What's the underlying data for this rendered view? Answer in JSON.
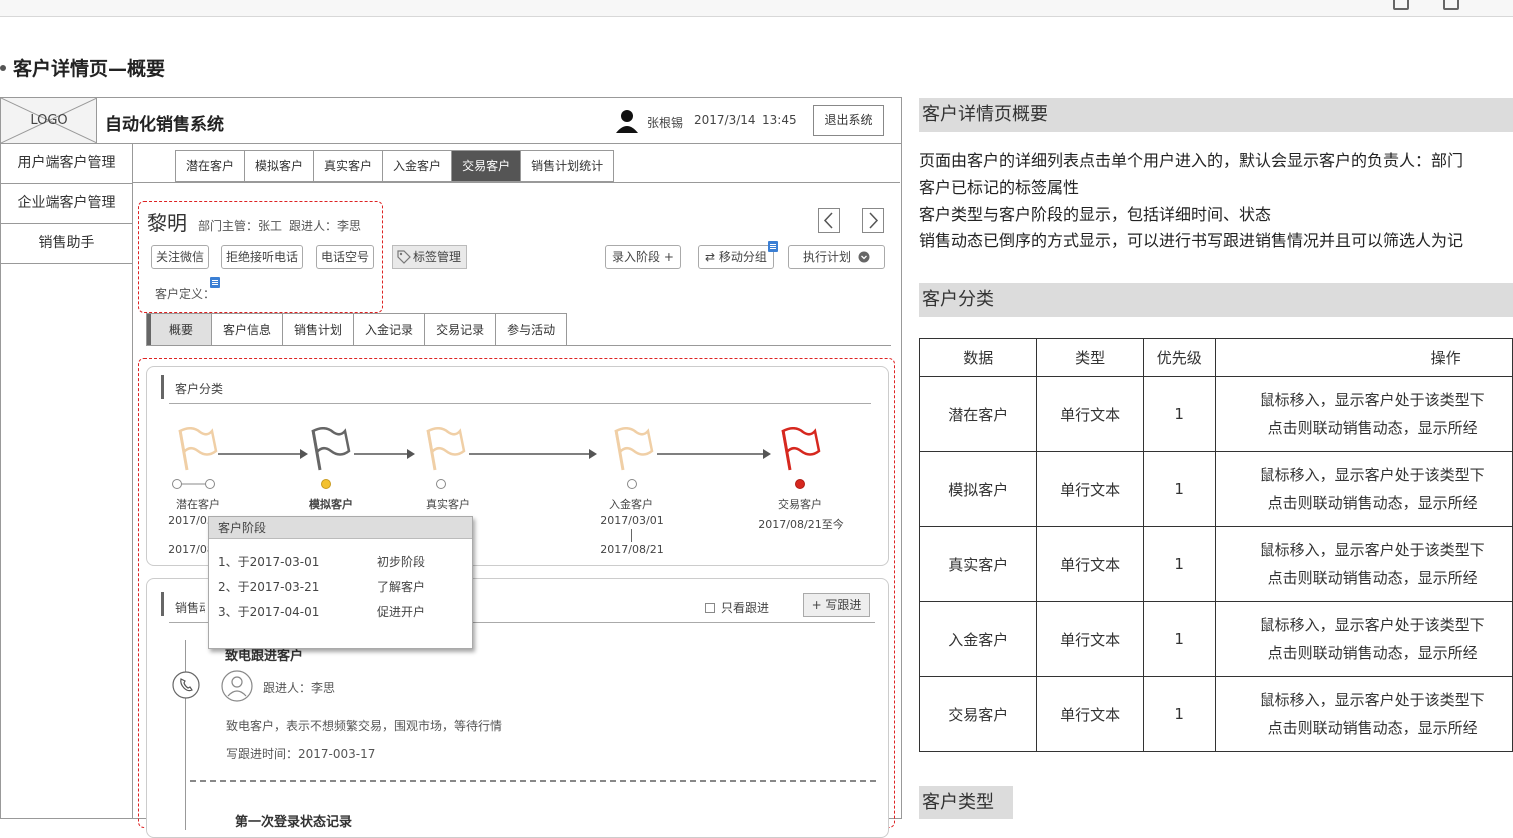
{
  "page": {
    "title": "客户详情页—概要"
  },
  "app": {
    "logo": "LOGO",
    "name": "自动化销售系统",
    "user": "张根锡",
    "date": "2017/3/14",
    "time": "13:45",
    "logout": "退出系统"
  },
  "sidenav": {
    "items": [
      "用户端客户管理",
      "企业端客户管理",
      "销售助手"
    ]
  },
  "nav_tabs": {
    "items": [
      "潜在客户",
      "模拟客户",
      "真实客户",
      "入金客户",
      "交易客户",
      "销售计划统计"
    ],
    "active": "交易客户"
  },
  "customer": {
    "name": "黎明",
    "manager": "部门主管：张工",
    "follower": "跟进人：李思",
    "tags": [
      "关注微信",
      "拒绝接听电话",
      "电话空号"
    ],
    "tag_manage": "标签管理",
    "definition_label": "客户定义：",
    "actions": {
      "enter_stage": "录入阶段 +",
      "move_group": "⇄ 移动分组",
      "exec_plan": "执行计划"
    }
  },
  "sub_tabs": {
    "items": [
      "概要",
      "客户信息",
      "销售计划",
      "入金记录",
      "交易记录",
      "参与活动"
    ],
    "active": "概要"
  },
  "classification_card": {
    "title": "客户分类",
    "stages": [
      {
        "label": "潜在客户",
        "date1": "2017/03",
        "date2": "2017/08",
        "flag_color": "#f0cfa6"
      },
      {
        "label": "模拟客户",
        "date1": "",
        "date2": "",
        "flag_color": "#666666"
      },
      {
        "label": "真实客户",
        "date1": "",
        "date2": "",
        "flag_color": "#f0cfa6"
      },
      {
        "label": "入金客户",
        "date1": "2017/03/01",
        "date2": "2017/08/21",
        "flag_color": "#f0cfa6"
      },
      {
        "label": "交易客户",
        "date1": "2017/08/21至今",
        "date2": "",
        "flag_color": "#d6281f"
      }
    ]
  },
  "stage_popup": {
    "title": "客户阶段",
    "rows": [
      {
        "date": "1、于2017-03-01",
        "stage": "初步阶段"
      },
      {
        "date": "2、于2017-03-21",
        "stage": "了解客户"
      },
      {
        "date": "3、于2017-04-01",
        "stage": "促进开户"
      }
    ]
  },
  "sales_card": {
    "title": "销售动态",
    "only_follow": "只看跟进",
    "write_follow": "+ 写跟进",
    "entry": {
      "title": "致电跟进客户",
      "follower": "跟进人：李思",
      "desc": "致电客户，表示不想频繁交易，围观市场，等待行情",
      "time": "写跟进时间：2017-003-17"
    },
    "entry2_title": "第一次登录状态记录"
  },
  "doc": {
    "section1_title": "客户详情页概要",
    "lines": [
      "页面由客户的详细列表点击单个用户进入的，默认会显示客户的负责人：部门",
      "客户已标记的标签属性",
      "客户类型与客户阶段的显示，包括详细时间、状态",
      "销售动态已倒序的方式显示，可以进行书写跟进销售情况并且可以筛选人为记"
    ],
    "section2_title": "客户分类",
    "table": {
      "headers": [
        "数据",
        "类型",
        "优先级",
        "操作"
      ],
      "rows": [
        {
          "data": "潜在客户",
          "type": "单行文本",
          "priority": "1",
          "op1": "鼠标移入，显示客户处于该类型下",
          "op2": "点击则联动销售动态，显示所经"
        },
        {
          "data": "模拟客户",
          "type": "单行文本",
          "priority": "1",
          "op1": "鼠标移入，显示客户处于该类型下",
          "op2": "点击则联动销售动态，显示所经"
        },
        {
          "data": "真实客户",
          "type": "单行文本",
          "priority": "1",
          "op1": "鼠标移入，显示客户处于该类型下",
          "op2": "点击则联动销售动态，显示所经"
        },
        {
          "data": "入金客户",
          "type": "单行文本",
          "priority": "1",
          "op1": "鼠标移入，显示客户处于该类型下",
          "op2": "点击则联动销售动态，显示所经"
        },
        {
          "data": "交易客户",
          "type": "单行文本",
          "priority": "1",
          "op1": "鼠标移入，显示客户处于该类型下",
          "op2": "点击则联动销售动态，显示所经"
        }
      ]
    },
    "section3_title": "客户类型"
  }
}
